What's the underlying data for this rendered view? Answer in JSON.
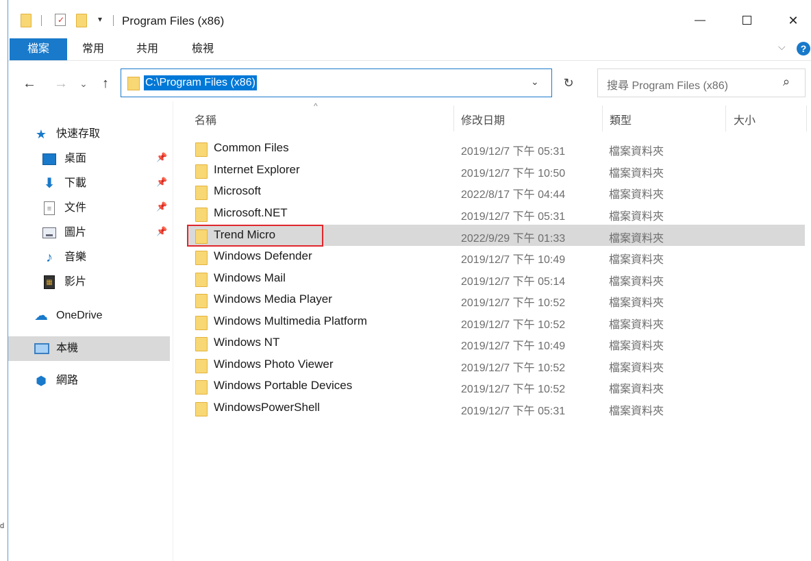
{
  "window": {
    "title": "Program Files (x86)",
    "controls": {
      "minimize": "—",
      "maximize": "",
      "close": "✕"
    },
    "qa_dropdown": "▾"
  },
  "ribbon": {
    "tabs": [
      "檔案",
      "常用",
      "共用",
      "檢視"
    ],
    "chevron": "⌵",
    "help": "?"
  },
  "nav": {
    "back": "←",
    "forward": "→",
    "recent": "⌄",
    "up": "↑",
    "address": "C:\\Program Files (x86)",
    "address_dropdown": "⌄",
    "refresh": "↻",
    "search_placeholder": "搜尋 Program Files (x86)",
    "search_icon": "⌕"
  },
  "sidebar": {
    "quick_access": "快速存取",
    "items": [
      {
        "label": "桌面",
        "icon": "desktop-icon",
        "pinned": true
      },
      {
        "label": "下載",
        "icon": "download-icon",
        "pinned": true
      },
      {
        "label": "文件",
        "icon": "document-icon",
        "pinned": true
      },
      {
        "label": "圖片",
        "icon": "picture-icon",
        "pinned": true
      },
      {
        "label": "音樂",
        "icon": "music-icon",
        "pinned": false
      },
      {
        "label": "影片",
        "icon": "video-icon",
        "pinned": false
      }
    ],
    "onedrive": "OneDrive",
    "this_pc": "本機",
    "network": "網路",
    "pin_glyph": "📌"
  },
  "columns": {
    "name": "名稱",
    "date": "修改日期",
    "type": "類型",
    "size": "大小",
    "sort_caret": "^"
  },
  "files": [
    {
      "name": "Common Files",
      "date": "2019/12/7 下午 05:31",
      "type": "檔案資料夾"
    },
    {
      "name": "Internet Explorer",
      "date": "2019/12/7 下午 10:50",
      "type": "檔案資料夾"
    },
    {
      "name": "Microsoft",
      "date": "2022/8/17 下午 04:44",
      "type": "檔案資料夾"
    },
    {
      "name": "Microsoft.NET",
      "date": "2019/12/7 下午 05:31",
      "type": "檔案資料夾"
    },
    {
      "name": "Trend Micro",
      "date": "2022/9/29 下午 01:33",
      "type": "檔案資料夾",
      "selected": true
    },
    {
      "name": "Windows Defender",
      "date": "2019/12/7 下午 10:49",
      "type": "檔案資料夾"
    },
    {
      "name": "Windows Mail",
      "date": "2019/12/7 下午 05:14",
      "type": "檔案資料夾"
    },
    {
      "name": "Windows Media Player",
      "date": "2019/12/7 下午 10:52",
      "type": "檔案資料夾"
    },
    {
      "name": "Windows Multimedia Platform",
      "date": "2019/12/7 下午 10:52",
      "type": "檔案資料夾"
    },
    {
      "name": "Windows NT",
      "date": "2019/12/7 下午 10:49",
      "type": "檔案資料夾"
    },
    {
      "name": "Windows Photo Viewer",
      "date": "2019/12/7 下午 10:52",
      "type": "檔案資料夾"
    },
    {
      "name": "Windows Portable Devices",
      "date": "2019/12/7 下午 10:52",
      "type": "檔案資料夾"
    },
    {
      "name": "WindowsPowerShell",
      "date": "2019/12/7 下午 05:31",
      "type": "檔案資料夾"
    }
  ],
  "edge_text": "d",
  "colors": {
    "accent": "#1979ca",
    "highlight": "#d9d9d9",
    "annotation": "#e0262c",
    "folder": "#f8d775"
  }
}
